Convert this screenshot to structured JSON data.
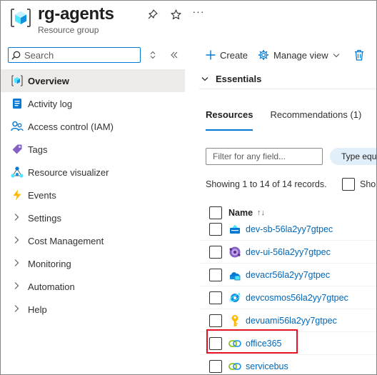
{
  "header": {
    "title": "rg-agents",
    "subtitle": "Resource group",
    "icons": [
      "pin-icon",
      "star-icon",
      "more-icon"
    ]
  },
  "sidebar": {
    "search_placeholder": "Search",
    "items": [
      {
        "label": "Overview",
        "icon": "overview-icon",
        "active": true
      },
      {
        "label": "Activity log",
        "icon": "activity-log-icon"
      },
      {
        "label": "Access control (IAM)",
        "icon": "iam-icon"
      },
      {
        "label": "Tags",
        "icon": "tag-icon"
      },
      {
        "label": "Resource visualizer",
        "icon": "visualizer-icon"
      },
      {
        "label": "Events",
        "icon": "events-icon"
      },
      {
        "label": "Settings",
        "expandable": true
      },
      {
        "label": "Cost Management",
        "expandable": true
      },
      {
        "label": "Monitoring",
        "expandable": true
      },
      {
        "label": "Automation",
        "expandable": true
      },
      {
        "label": "Help",
        "expandable": true
      }
    ]
  },
  "toolbar": {
    "create_label": "Create",
    "manage_view_label": "Manage view"
  },
  "essentials": {
    "label": "Essentials"
  },
  "tabs": [
    {
      "label": "Resources",
      "active": true
    },
    {
      "label": "Recommendations (1)"
    }
  ],
  "filter": {
    "placeholder": "Filter for any field...",
    "type_pill": "Type equ"
  },
  "records": {
    "summary": "Showing 1 to 14 of 14 records.",
    "show_label": "Sho"
  },
  "table": {
    "name_header": "Name",
    "sort_indicator": "↑↓",
    "rows": [
      {
        "name": "dev-sb-56la2yy7gtpec",
        "icon": "service-bus-namespace-icon"
      },
      {
        "name": "dev-ui-56la2yy7gtpec",
        "icon": "container-app-icon"
      },
      {
        "name": "devacr56la2yy7gtpec",
        "icon": "container-registry-icon"
      },
      {
        "name": "devcosmos56la2yy7gtpec",
        "icon": "cosmos-db-icon"
      },
      {
        "name": "devuami56la2yy7gtpec",
        "icon": "managed-identity-icon"
      },
      {
        "name": "office365",
        "icon": "api-connection-icon",
        "highlighted": true
      },
      {
        "name": "servicebus",
        "icon": "api-connection-icon"
      }
    ]
  },
  "colors": {
    "accent": "#0078d4",
    "link": "#0067b8",
    "highlight_border": "#e81123",
    "active_nav_bg": "#edebe9"
  }
}
